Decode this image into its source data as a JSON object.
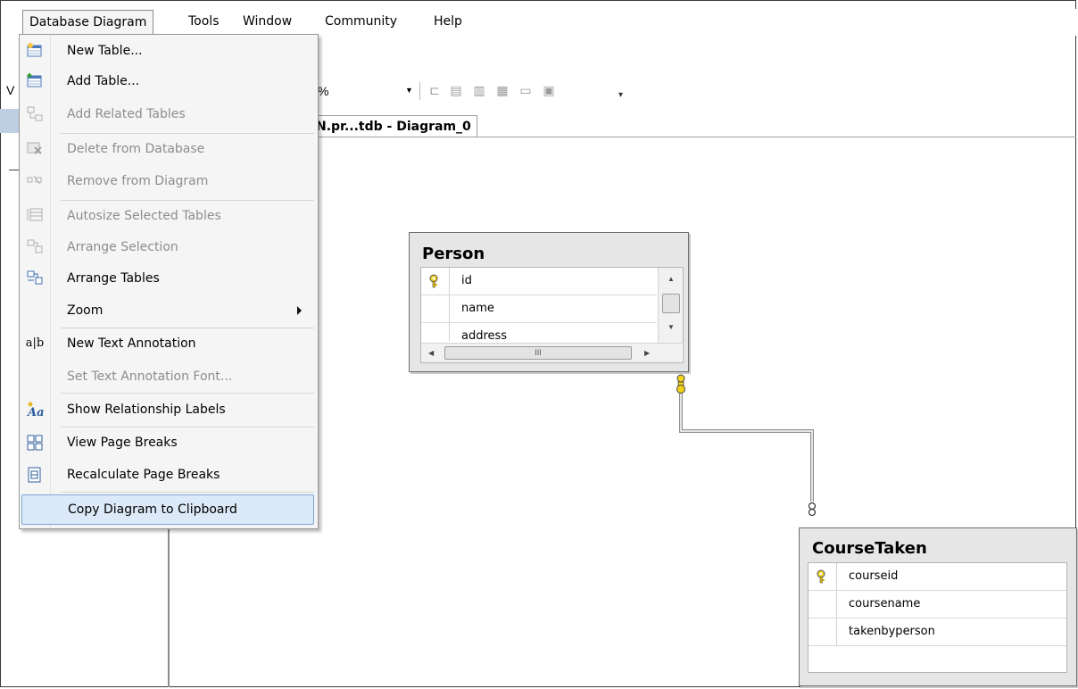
{
  "menubar": {
    "items": [
      "Database Diagram",
      "Tools",
      "Window",
      "Community",
      "Help"
    ]
  },
  "toolbar": {
    "zoom_value_fragment": "%",
    "left_fragment": "V"
  },
  "document_tab": {
    "label": "N.pr...tdb - Diagram_0"
  },
  "context_menu": {
    "items": [
      {
        "label": "New Table...",
        "icon": "new-table-icon",
        "enabled": true
      },
      {
        "label": "Add Table...",
        "icon": "add-table-icon",
        "enabled": true
      },
      {
        "label": "Add Related Tables",
        "icon": "add-related-tables-icon",
        "enabled": false
      },
      {
        "label": "Delete from Database",
        "icon": "delete-from-database-icon",
        "enabled": false
      },
      {
        "label": "Remove from Diagram",
        "icon": "remove-from-diagram-icon",
        "enabled": false
      },
      {
        "label": "Autosize Selected Tables",
        "icon": "autosize-icon",
        "enabled": false
      },
      {
        "label": "Arrange Selection",
        "icon": "arrange-selection-icon",
        "enabled": false
      },
      {
        "label": "Arrange Tables",
        "icon": "arrange-tables-icon",
        "enabled": true
      },
      {
        "label": "Zoom",
        "icon": "",
        "enabled": true,
        "submenu": true
      },
      {
        "label": "New Text Annotation",
        "icon": "text-annotation-icon",
        "icon_text": "a|b",
        "enabled": true
      },
      {
        "label": "Set Text Annotation Font...",
        "icon": "",
        "enabled": false
      },
      {
        "label": "Show Relationship Labels",
        "icon": "relationship-labels-icon",
        "enabled": true
      },
      {
        "label": "View Page Breaks",
        "icon": "view-page-breaks-icon",
        "enabled": true
      },
      {
        "label": "Recalculate Page Breaks",
        "icon": "recalculate-page-breaks-icon",
        "enabled": true
      },
      {
        "label": "Copy Diagram to Clipboard",
        "icon": "",
        "enabled": true,
        "highlighted": true
      }
    ]
  },
  "tables": {
    "person": {
      "title": "Person",
      "columns": [
        {
          "name": "id",
          "primary_key": true
        },
        {
          "name": "name",
          "primary_key": false
        },
        {
          "name": "address",
          "primary_key": false
        }
      ],
      "hscroll_label": "III"
    },
    "course_taken": {
      "title": "CourseTaken",
      "columns": [
        {
          "name": "courseid",
          "primary_key": true
        },
        {
          "name": "coursename",
          "primary_key": false
        },
        {
          "name": "takenbyperson",
          "primary_key": false
        }
      ]
    }
  },
  "colors": {
    "menu_highlight": "#dce9f8",
    "menu_highlight_border": "#7aa7d8",
    "key_yellow": "#f2d21a",
    "disabled_text": "#8d8d8d"
  }
}
